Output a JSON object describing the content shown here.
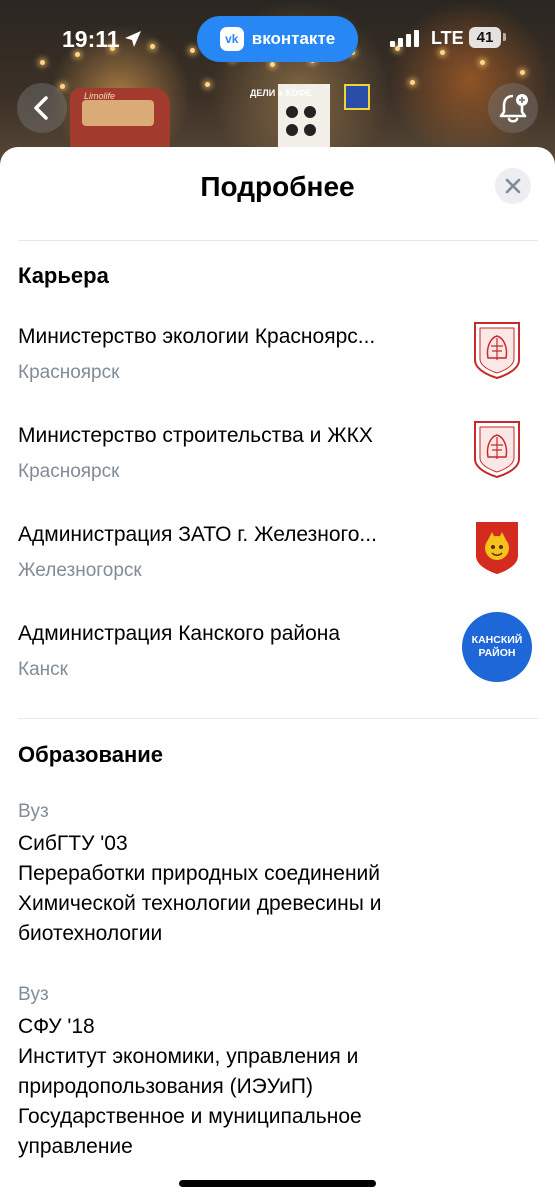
{
  "status_bar": {
    "time": "19:11",
    "app_pill": "вконтакте",
    "vk_logo": "vk",
    "network": "LTE",
    "battery": "41"
  },
  "background_photo": {
    "van_text": "Limolife",
    "kiosk_text": "ДЕЛИ ● КОФЕ"
  },
  "sheet": {
    "title": "Подробнее",
    "career": {
      "title": "Карьера",
      "items": [
        {
          "name": "Министерство экологии Красноярс...",
          "city": "Красноярск",
          "logo": "krasnoyarsk-coat-of-arms"
        },
        {
          "name": "Министерство строительства и ЖКХ",
          "city": "Красноярск",
          "logo": "krasnoyarsk-coat-of-arms"
        },
        {
          "name": "Администрация ЗАТО г. Железного...",
          "city": "Железногорск",
          "logo": "zheleznogorsk-coat-of-arms"
        },
        {
          "name": "Администрация Канского района",
          "city": "Канск",
          "logo_text_1": "КАНСКИЙ",
          "logo_text_2": "РАЙОН"
        }
      ]
    },
    "education": {
      "title": "Образование",
      "items": [
        {
          "type": "Вуз",
          "lines": [
            "СибГТУ '03",
            "Переработки природных соединений",
            "Химической технологии древесины и",
            "биотехнологии"
          ]
        },
        {
          "type": "Вуз",
          "lines": [
            "СФУ '18",
            "Институт экономики, управления и",
            "природопользования (ИЭУиП)",
            "Государственное и муниципальное",
            "управление"
          ]
        }
      ]
    }
  },
  "colors": {
    "accent": "#2787f5",
    "secondary_text": "#818c99",
    "coat_red": "#c62b2b",
    "kansk_blue": "#1d67d8"
  }
}
